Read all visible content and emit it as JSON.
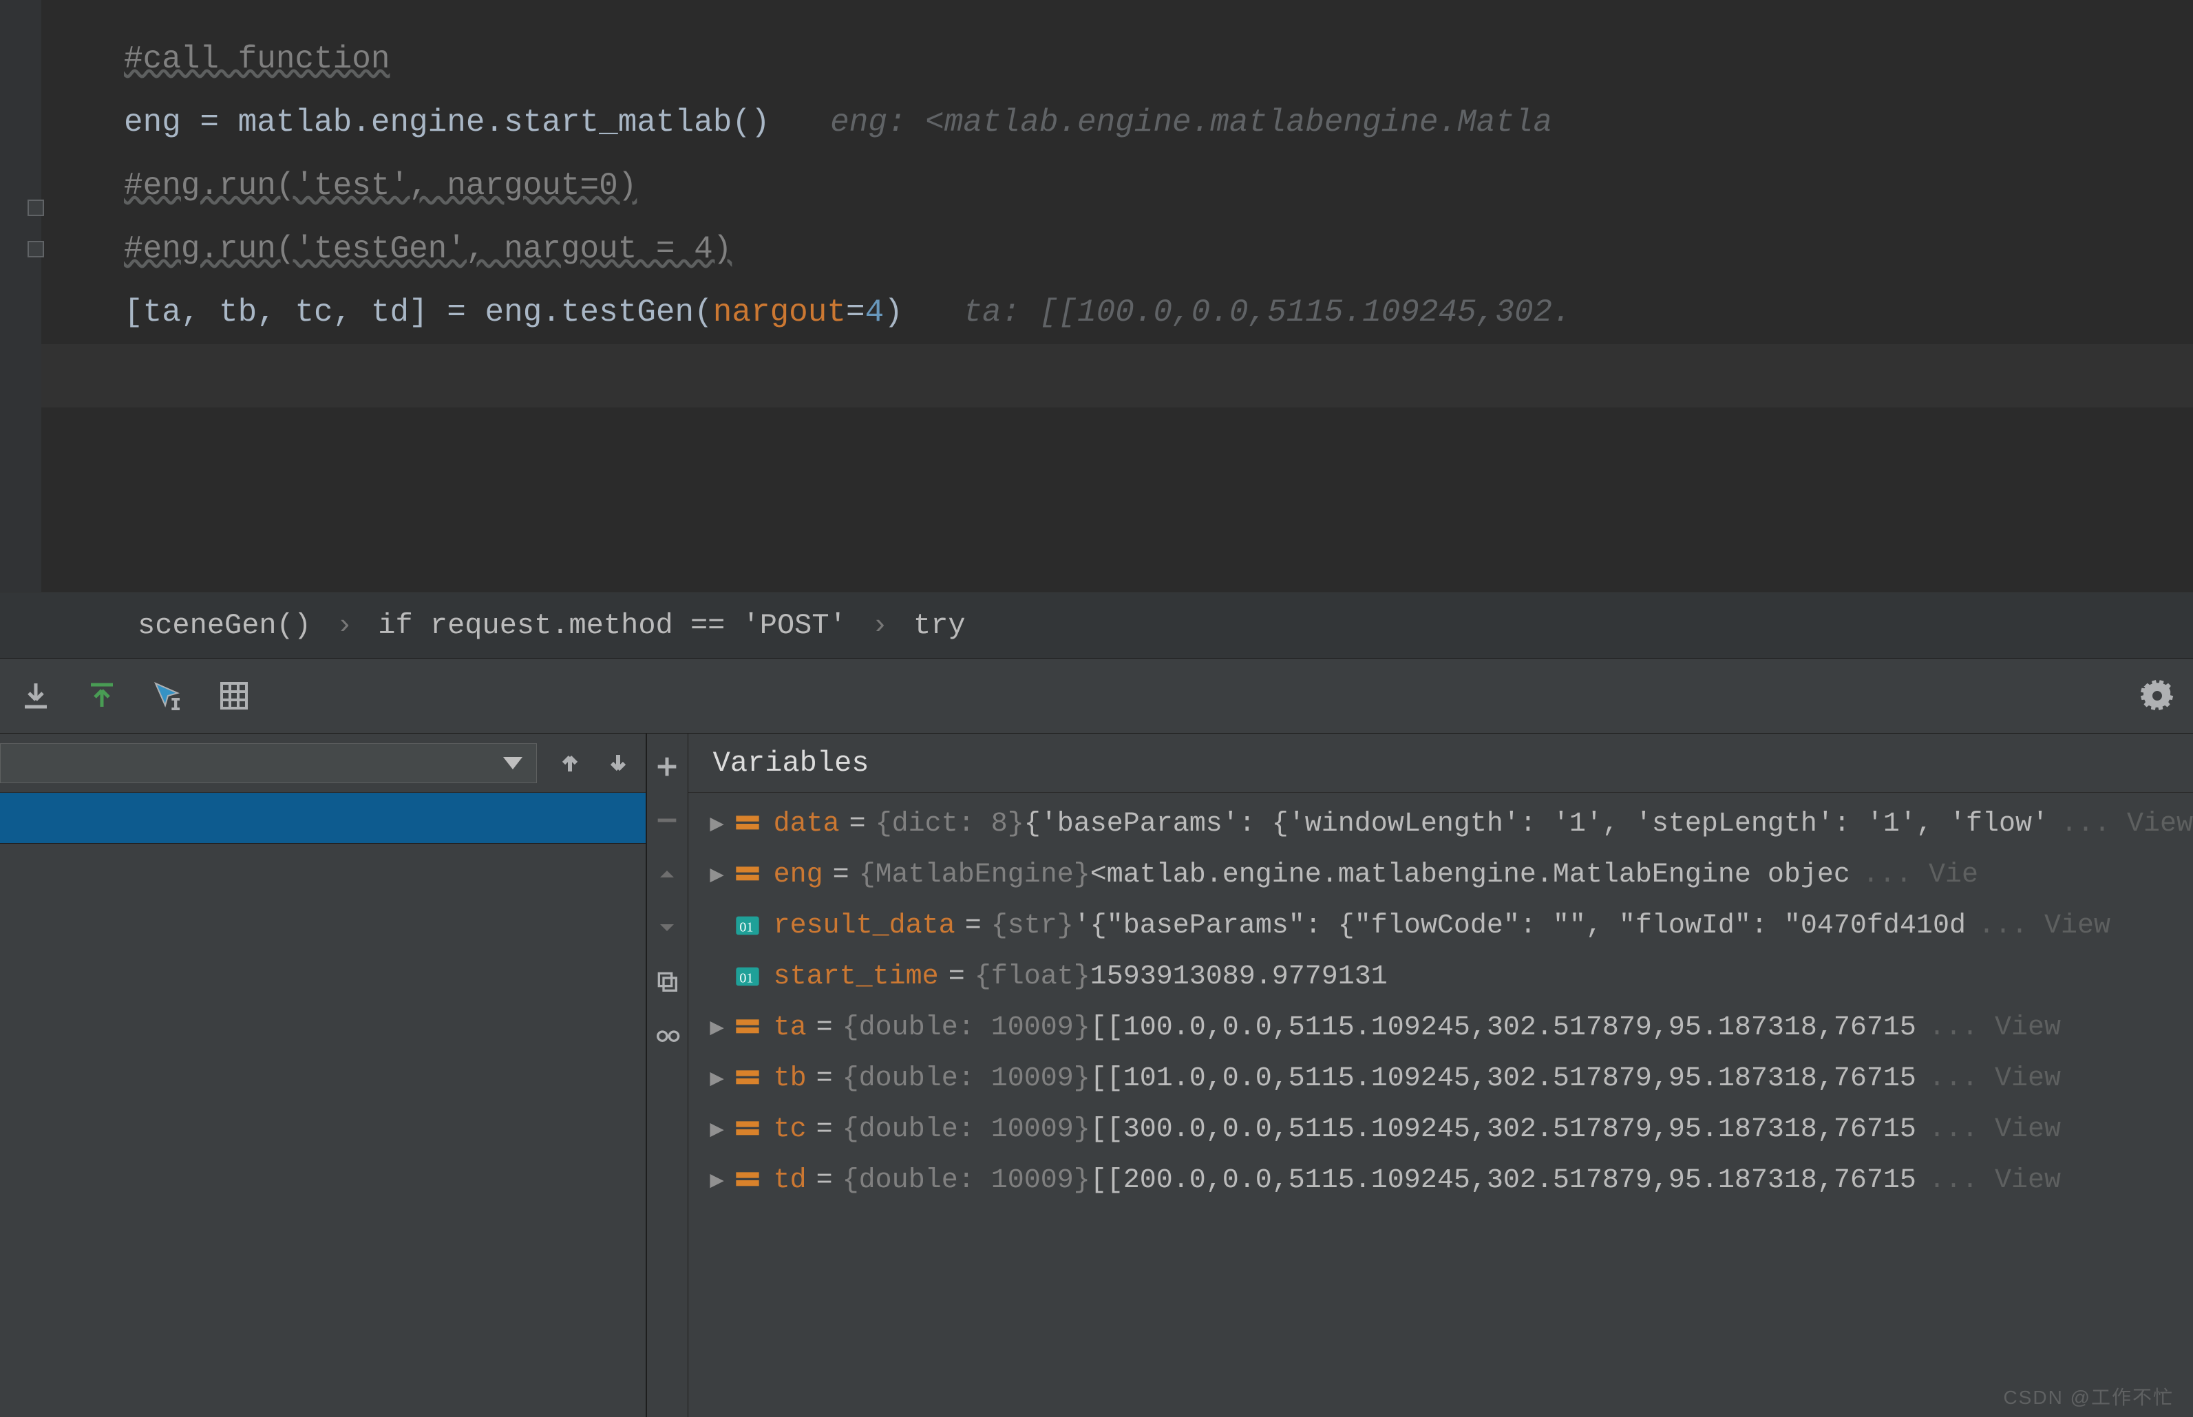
{
  "code": {
    "l1_comment": "#call function",
    "l2_text": "eng = matlab.engine.start_matlab()",
    "l2_hint": "eng: <matlab.engine.matlabengine.Matla",
    "l3_comment": "#eng.run('test', nargout=0)",
    "l4_comment": "#eng.run('testGen', nargout = 4)",
    "l5_pre": "[ta, tb, tc, td] = eng.testGen(",
    "l5_kw": "nargout",
    "l5_eq": "=",
    "l5_num": "4",
    "l5_post": ")",
    "l5_hint": "ta: [[100.0,0.0,5115.109245,302."
  },
  "breadcrumb": {
    "a": "sceneGen()",
    "b": "if request.method == 'POST'",
    "c": "try"
  },
  "vars_title": "Variables",
  "vars": [
    {
      "expand": true,
      "kind": "obj",
      "name": "data",
      "type": "{dict: 8}",
      "val": "{'baseParams': {'windowLength': '1', 'stepLength': '1', 'flow'",
      "view": "... View"
    },
    {
      "expand": true,
      "kind": "obj",
      "name": "eng",
      "type": "{MatlabEngine}",
      "val": "<matlab.engine.matlabengine.MatlabEngine objec",
      "view": "... Vie"
    },
    {
      "expand": false,
      "kind": "str",
      "name": "result_data",
      "type": "{str}",
      "val": "'{\"baseParams\": {\"flowCode\": \"\", \"flowId\": \"0470fd410d",
      "view": "... View"
    },
    {
      "expand": false,
      "kind": "str",
      "name": "start_time",
      "type": "{float}",
      "val": "1593913089.9779131",
      "view": ""
    },
    {
      "expand": true,
      "kind": "obj",
      "name": "ta",
      "type": "{double: 10009}",
      "val": "[[100.0,0.0,5115.109245,302.517879,95.187318,76715",
      "view": "... View"
    },
    {
      "expand": true,
      "kind": "obj",
      "name": "tb",
      "type": "{double: 10009}",
      "val": "[[101.0,0.0,5115.109245,302.517879,95.187318,76715",
      "view": "... View"
    },
    {
      "expand": true,
      "kind": "obj",
      "name": "tc",
      "type": "{double: 10009}",
      "val": "[[300.0,0.0,5115.109245,302.517879,95.187318,76715",
      "view": "... View"
    },
    {
      "expand": true,
      "kind": "obj",
      "name": "td",
      "type": "{double: 10009}",
      "val": "[[200.0,0.0,5115.109245,302.517879,95.187318,76715",
      "view": "... View"
    }
  ],
  "watermark": "CSDN @工作不忙"
}
